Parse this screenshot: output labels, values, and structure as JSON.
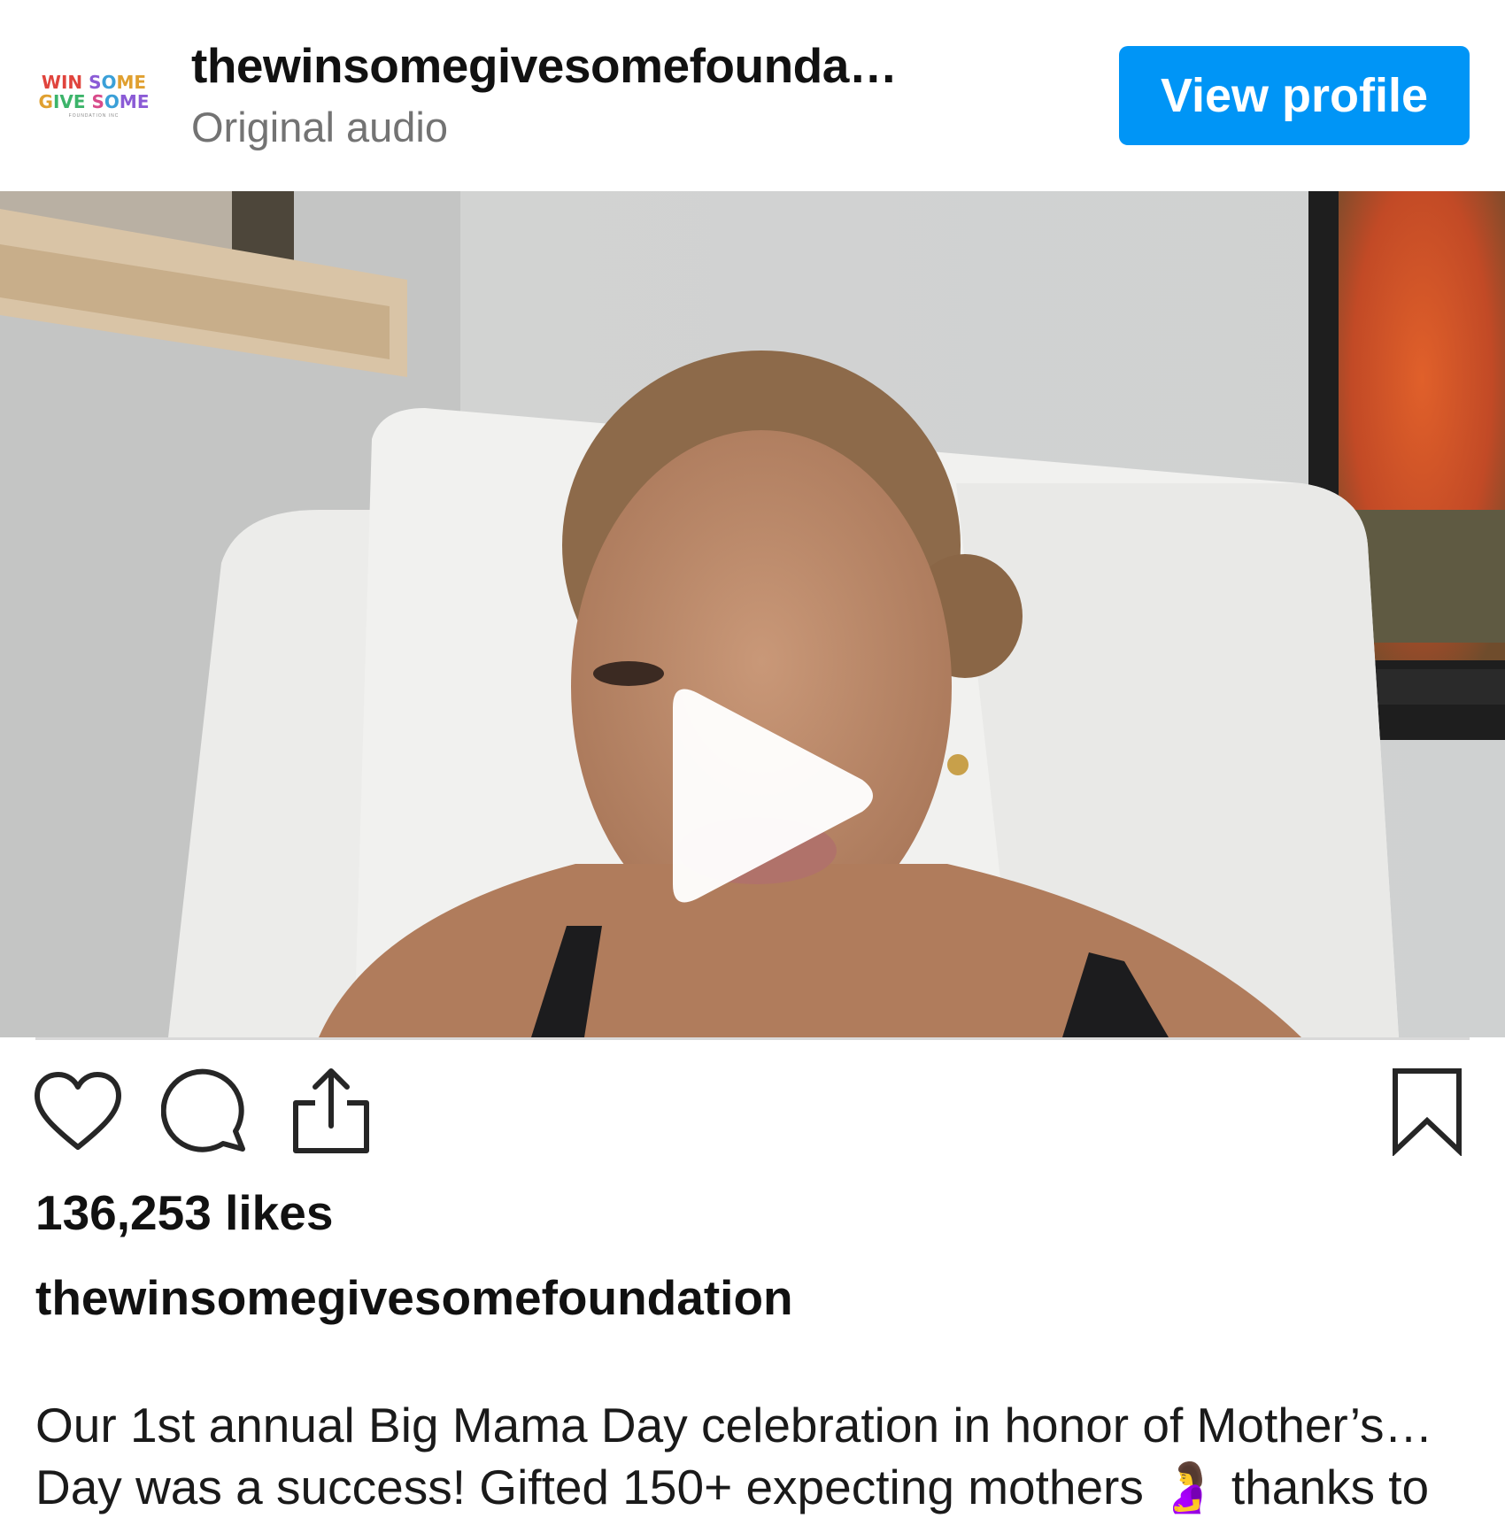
{
  "header": {
    "avatar_logo": {
      "line1": "WIN SOME",
      "line2": "GIVE SOME",
      "sub": "FOUNDATION INC"
    },
    "username": "thewinsomegivesomefounda…",
    "audio_label": "Original audio",
    "view_profile_label": "View profile",
    "accent_color": "#0095f6"
  },
  "video": {
    "state": "paused",
    "overlay_icon": "play-icon"
  },
  "actions": {
    "icons": [
      "heart-icon",
      "comment-icon",
      "share-icon",
      "bookmark-icon"
    ]
  },
  "likes": {
    "text": "136,253 likes"
  },
  "caption": {
    "username": "thewinsomegivesomefoundation",
    "line1": "Our 1st annual Big Mama Day celebration in honor of Mother’s…",
    "line2": "Day was a success! Gifted 150+ expecting mothers 🤰 thanks to"
  }
}
